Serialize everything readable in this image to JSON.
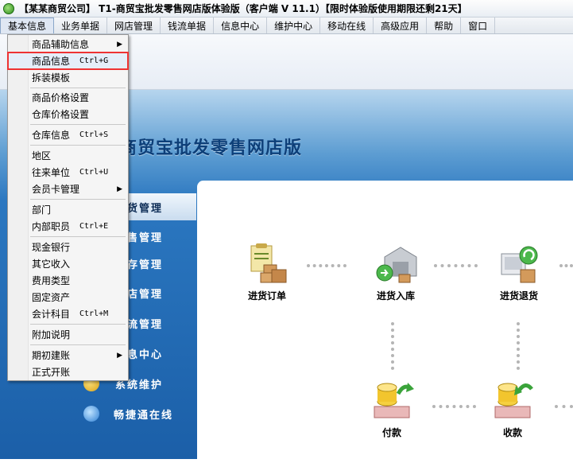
{
  "window": {
    "title": "【某某商贸公司】 T1-商贸宝批发零售网店版体验版（客户端 V 11.1）【限时体验版使用期限还剩21天】"
  },
  "menubar": {
    "items": [
      "基本信息",
      "业务单据",
      "网店管理",
      "钱流单据",
      "信息中心",
      "维护中心",
      "移动在线",
      "高级应用",
      "帮助",
      "窗口"
    ]
  },
  "banner": {
    "title": "商贸宝批发零售网店版"
  },
  "leftnav": {
    "items": [
      "进货管理",
      "销售管理",
      "库存管理",
      "网店管理",
      "钱流管理",
      "信息中心",
      "系统维护",
      "畅捷通在线"
    ],
    "visible_text": [
      "货管理",
      "售管理",
      "存管理",
      "店管理",
      "流管理",
      "息中心",
      "系统维护",
      "畅捷通在线"
    ]
  },
  "flow": {
    "nodes": [
      "进货订单",
      "进货入库",
      "进货退货",
      "付款",
      "收款"
    ]
  },
  "dropdown": {
    "items": [
      {
        "label": "商品辅助信息",
        "shortcut": "",
        "submenu": true
      },
      {
        "label": "商品信息",
        "shortcut": "Ctrl+G",
        "submenu": false
      },
      {
        "label": "拆装模板",
        "shortcut": "",
        "submenu": false
      },
      {
        "label": "商品价格设置",
        "shortcut": "",
        "submenu": false
      },
      {
        "label": "仓库价格设置",
        "shortcut": "",
        "submenu": false
      },
      {
        "label": "仓库信息",
        "shortcut": "Ctrl+S",
        "submenu": false
      },
      {
        "label": "地区",
        "shortcut": "",
        "submenu": false
      },
      {
        "label": "往来单位",
        "shortcut": "Ctrl+U",
        "submenu": false
      },
      {
        "label": "会员卡管理",
        "shortcut": "",
        "submenu": true
      },
      {
        "label": "部门",
        "shortcut": "",
        "submenu": false
      },
      {
        "label": "内部职员",
        "shortcut": "Ctrl+E",
        "submenu": false
      },
      {
        "label": "现金银行",
        "shortcut": "",
        "submenu": false
      },
      {
        "label": "其它收入",
        "shortcut": "",
        "submenu": false
      },
      {
        "label": "费用类型",
        "shortcut": "",
        "submenu": false
      },
      {
        "label": "固定资产",
        "shortcut": "",
        "submenu": false
      },
      {
        "label": "会计科目",
        "shortcut": "Ctrl+M",
        "submenu": false
      },
      {
        "label": "附加说明",
        "shortcut": "",
        "submenu": false
      },
      {
        "label": "期初建账",
        "shortcut": "",
        "submenu": true
      },
      {
        "label": "正式开账",
        "shortcut": "",
        "submenu": false
      }
    ],
    "highlighted": "商品信息"
  },
  "colors": {
    "accent_blue": "#1b5fa8",
    "highlight_border": "#e33333"
  }
}
